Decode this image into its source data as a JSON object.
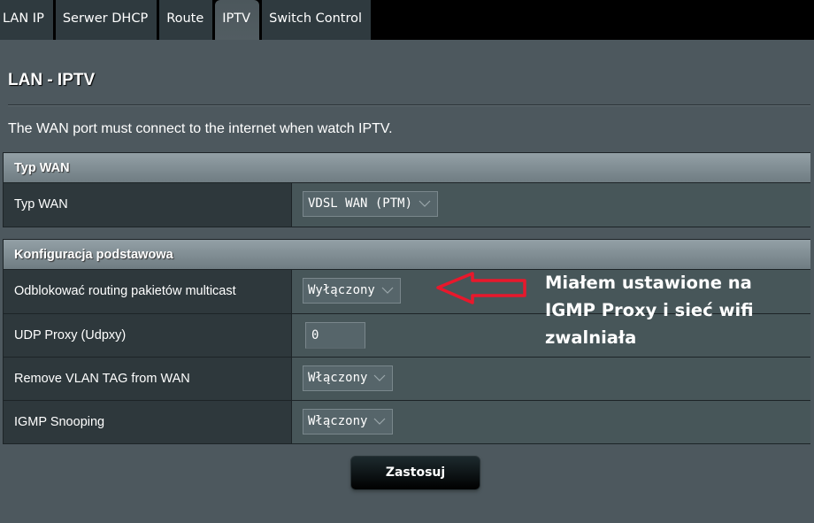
{
  "tabs": [
    {
      "label": "LAN IP",
      "active": false
    },
    {
      "label": "Serwer DHCP",
      "active": false
    },
    {
      "label": "Route",
      "active": false
    },
    {
      "label": "IPTV",
      "active": true
    },
    {
      "label": "Switch Control",
      "active": false
    }
  ],
  "page": {
    "title": "LAN - IPTV",
    "description": "The WAN port must connect to the internet when watch IPTV."
  },
  "sections": {
    "wan_type": {
      "header": "Typ WAN",
      "rows": [
        {
          "label": "Typ WAN",
          "type": "select",
          "value": "VDSL WAN (PTM)"
        }
      ]
    },
    "basic_config": {
      "header": "Konfiguracja podstawowa",
      "rows": [
        {
          "label": "Odblokować routing pakietów multicast",
          "type": "select",
          "value": "Wyłączony"
        },
        {
          "label": "UDP Proxy (Udpxy)",
          "type": "input",
          "value": "0"
        },
        {
          "label": "Remove VLAN TAG from WAN",
          "type": "select",
          "value": "Włączony"
        },
        {
          "label": "IGMP Snooping",
          "type": "select",
          "value": "Włączony"
        }
      ]
    }
  },
  "apply_button": {
    "label": "Zastosuj"
  },
  "annotation": {
    "lines": [
      "Miałem ustawione na",
      "IGMP Proxy i sieć wifi",
      "zwalniała"
    ],
    "arrow_color": "#e8182c"
  }
}
